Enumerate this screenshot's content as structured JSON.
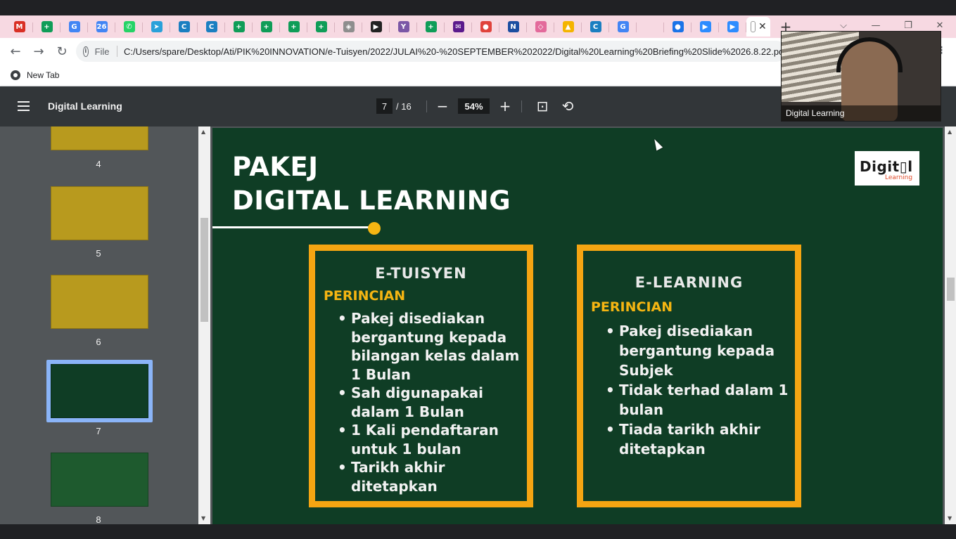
{
  "browser": {
    "tabs": [
      {
        "icon": "gmail-icon",
        "glyph": "M",
        "color": "#d93025"
      },
      {
        "icon": "sheets-icon",
        "glyph": "+",
        "color": "#0f9d58"
      },
      {
        "icon": "google-icon",
        "glyph": "G",
        "color": "#4285f4"
      },
      {
        "icon": "calendar-icon",
        "glyph": "26",
        "color": "#4285f4"
      },
      {
        "icon": "whatsapp-icon",
        "glyph": "✆",
        "color": "#25d366"
      },
      {
        "icon": "telegram-icon",
        "glyph": "➤",
        "color": "#2aa1da"
      },
      {
        "icon": "canva-icon",
        "glyph": "C",
        "color": "#1b7fc1"
      },
      {
        "icon": "canva-icon",
        "glyph": "C",
        "color": "#1b7fc1"
      },
      {
        "icon": "sheets-icon",
        "glyph": "+",
        "color": "#0f9d58"
      },
      {
        "icon": "sheets-icon",
        "glyph": "+",
        "color": "#0f9d58"
      },
      {
        "icon": "sheets-icon",
        "glyph": "+",
        "color": "#0f9d58"
      },
      {
        "icon": "sheets-icon",
        "glyph": "+",
        "color": "#0f9d58"
      },
      {
        "icon": "shield-icon",
        "glyph": "◈",
        "color": "#8e8e8e"
      },
      {
        "icon": "play-icon",
        "glyph": "▶",
        "color": "#222222"
      },
      {
        "icon": "filter-icon",
        "glyph": "Y",
        "color": "#7b57a6"
      },
      {
        "icon": "sheets-icon",
        "glyph": "+",
        "color": "#0f9d58"
      },
      {
        "icon": "mail-icon",
        "glyph": "✉",
        "color": "#5b1a8c"
      },
      {
        "icon": "record-icon",
        "glyph": "●",
        "color": "#e0433c"
      },
      {
        "icon": "translate-icon",
        "glyph": "N",
        "color": "#1c4ea1"
      },
      {
        "icon": "box-icon",
        "glyph": "◇",
        "color": "#e36a9b"
      },
      {
        "icon": "drive-icon",
        "glyph": "▲",
        "color": "#f4b400"
      },
      {
        "icon": "canva-icon",
        "glyph": "C",
        "color": "#1b7fc1"
      },
      {
        "icon": "google-icon",
        "glyph": "G",
        "color": "#4285f4"
      },
      {
        "icon": "blank-icon",
        "glyph": "",
        "color": "#f7d9e2"
      },
      {
        "icon": "meet-icon",
        "glyph": "●",
        "color": "#1a73e8"
      },
      {
        "icon": "zoom-icon",
        "glyph": "▶",
        "color": "#2d8cff"
      },
      {
        "icon": "zoom-icon",
        "glyph": "▶",
        "color": "#2d8cff"
      }
    ],
    "active_tab_close": "✕",
    "new_tab": "+",
    "window_controls": [
      "⌵",
      "—",
      "❐",
      "✕"
    ],
    "nav": {
      "back": "←",
      "forward": "→",
      "reload": "↻"
    },
    "omnibox": {
      "info": "i",
      "scheme": "File",
      "url": "C:/Users/spare/Desktop/Ati/PIK%20INNOVATION/e-Tuisyen/2022/JULAI%20-%20SEPTEMBER%202022/Digital%20Learning%20Briefing%20Slide%2026.8.22.pdf"
    },
    "menu": "⋮",
    "bookmark": {
      "label": "New Tab"
    }
  },
  "pdf": {
    "title": "Digital Learning",
    "page_current": "7",
    "page_total": "/ 16",
    "zoom": "54%",
    "zoom_out": "−",
    "zoom_in": "+",
    "fit_icon": "⊡",
    "rotate_icon": "⟲",
    "thumbnails": [
      {
        "num": "4",
        "bg": "#b89a1e"
      },
      {
        "num": "5",
        "bg": "#b89a1e"
      },
      {
        "num": "6",
        "bg": "#b89a1e"
      },
      {
        "num": "7",
        "bg": "#0f3d25"
      },
      {
        "num": "8",
        "bg": "#1e5a2e"
      }
    ]
  },
  "slide": {
    "title_line1": "PAKEJ",
    "title_line2": "DIGITAL LEARNING",
    "logo_main": "Digit▯l",
    "logo_sub": "Learning",
    "accent": "#f5a512",
    "bg": "#0f3d25",
    "left_panel": {
      "heading": "E-TUISYEN",
      "sub": "PERINCIAN",
      "items": [
        "Pakej disediakan bergantung kepada bilangan kelas dalam 1 Bulan",
        "Sah digunapakai dalam 1 Bulan",
        "1 Kali pendaftaran untuk 1 bulan",
        "Tarikh akhir ditetapkan"
      ]
    },
    "right_panel": {
      "heading": "E-LEARNING",
      "sub": "PERINCIAN",
      "items": [
        "Pakej disediakan bergantung kepada Subjek",
        "Tidak terhad dalam 1 bulan",
        "Tiada tarikh akhir ditetapkan"
      ]
    }
  },
  "video": {
    "label": "Digital Learning"
  }
}
